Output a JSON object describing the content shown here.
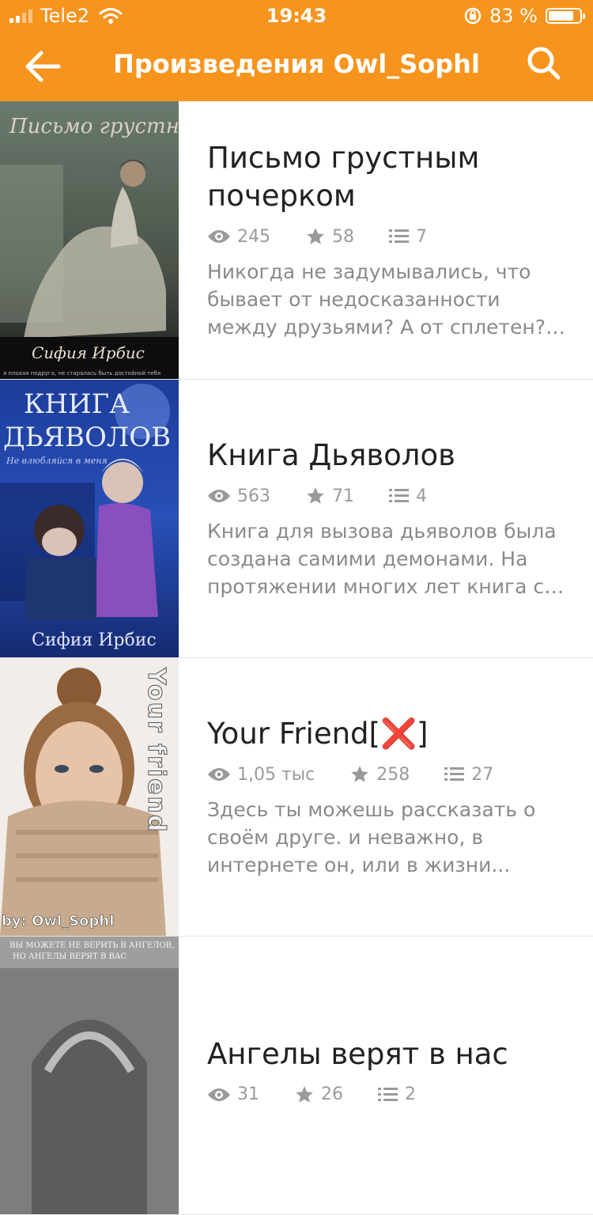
{
  "status_bar": {
    "carrier": "Tele2",
    "time": "19:43",
    "battery": "83 %",
    "battery_level": 0.83
  },
  "navbar": {
    "title": "Произведения Owl_Sophl"
  },
  "works": [
    {
      "title": "Письмо грустным почерком",
      "views": "245",
      "likes": "58",
      "chapters": "7",
      "description": "Никогда не задумывались, что бывает от недосказанности между друзьями? А от сплетен?…",
      "cover": {
        "title": "Письмо грустным почерком",
        "author": "Сифия Ирбис",
        "tagline": "я плохая подруга, не старалась быть достойной тебя"
      }
    },
    {
      "title": "Книга Дьяволов",
      "views": "563",
      "likes": "71",
      "chapters": "4",
      "description": "Книга для вызова дьяволов была создана самими демонами. На протяжении многих лет книга с…",
      "cover": {
        "title_line1": "КНИГА",
        "title_line2": "ДЬЯВОЛОВ",
        "tagline": "Не влюбляйся в меня",
        "author": "Сифия Ирбис"
      }
    },
    {
      "title": "Your Friend[❌]",
      "views": "1,05 тыс",
      "likes": "258",
      "chapters": "27",
      "description": "Здесь ты можешь рассказать о своём друге. и неважно, в интернете он, или в жизни... Зак…",
      "cover": {
        "vertical_text": "Your friend",
        "byline": "by: Owl_Sophl"
      }
    },
    {
      "title": "Ангелы верят в нас",
      "views": "31",
      "likes": "26",
      "chapters": "2",
      "description": "",
      "cover": {
        "line1": "ВЫ МОЖЕТЕ НЕ ВЕРИТЬ В АНГЕЛОВ,",
        "line2": "НО АНГЕЛЫ ВЕРЯТ В ВАС"
      }
    }
  ]
}
